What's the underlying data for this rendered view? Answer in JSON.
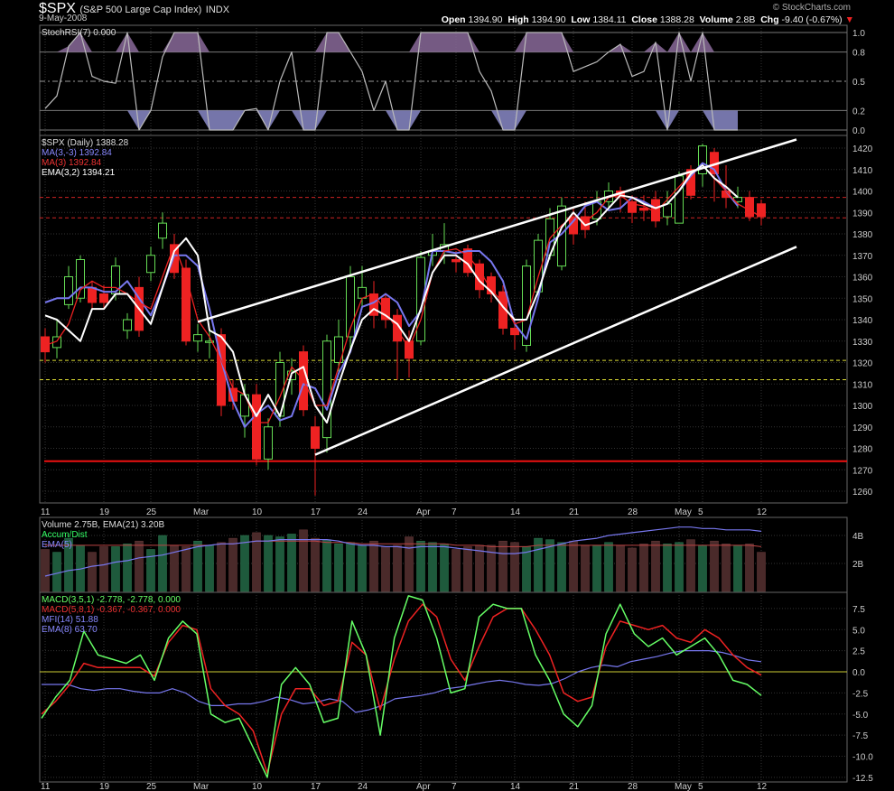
{
  "header": {
    "symbol": "$SPX",
    "description": "(S&P 500 Large Cap Index)",
    "exchange": "INDX",
    "date": "9-May-2008",
    "watermark": "© StockCharts.com",
    "open_label": "Open",
    "open": "1394.90",
    "high_label": "High",
    "high": "1394.90",
    "low_label": "Low",
    "low": "1384.11",
    "close_label": "Close",
    "close": "1388.28",
    "volume_label": "Volume",
    "volume": "2.8B",
    "chg_label": "Chg",
    "chg": "-9.40 (-0.67%)",
    "chg_marker": "▼"
  },
  "colors": {
    "up": "#66dd55",
    "down": "#ee2222",
    "ma33": "#7777ee",
    "ma3": "#ee2222",
    "ema32": "#ffffff",
    "stoch": "#bbbbbb",
    "accum": "#33ff66",
    "macd": "#66ff66",
    "macd_signal": "#ee2222",
    "mfi": "#7777ee"
  },
  "x_axis": {
    "ticks": [
      {
        "i": 0,
        "label": "11"
      },
      {
        "i": 5,
        "label": "19"
      },
      {
        "i": 9,
        "label": "25"
      },
      {
        "i": 13,
        "label": "Mar"
      },
      {
        "i": 18,
        "label": "10"
      },
      {
        "i": 23,
        "label": "17"
      },
      {
        "i": 27,
        "label": "24"
      },
      {
        "i": 32,
        "label": "Apr"
      },
      {
        "i": 35,
        "label": "7"
      },
      {
        "i": 40,
        "label": "14"
      },
      {
        "i": 45,
        "label": "21"
      },
      {
        "i": 50,
        "label": "28"
      },
      {
        "i": 54,
        "label": "May"
      },
      {
        "i": 56,
        "label": "5"
      },
      {
        "i": 61,
        "label": "12"
      }
    ]
  },
  "stoch_panel": {
    "legend": "StochRSI(7) 0.000",
    "y_ticks": [
      "1.0",
      "0.8",
      "0.5",
      "0.2",
      "0.0"
    ]
  },
  "price_panel": {
    "legend": [
      {
        "text": "$SPX (Daily) 1388.28",
        "color": "#dddddd"
      },
      {
        "text": "MA(3,-3) 1392.84",
        "color": "#8888ff"
      },
      {
        "text": "MA(3) 1392.84",
        "color": "#ee3333"
      },
      {
        "text": "EMA(3,2) 1394.21",
        "color": "#ffffff"
      }
    ],
    "y_ticks": [
      "1420",
      "1410",
      "1400",
      "1390",
      "1380",
      "1370",
      "1360",
      "1350",
      "1340",
      "1330",
      "1320",
      "1310",
      "1300",
      "1290",
      "1280",
      "1270",
      "1260"
    ]
  },
  "volume_panel": {
    "legend": [
      {
        "text": "Volume 2.75B, EMA(21) 3.20B",
        "color": "#dddddd"
      },
      {
        "text": "Accum/Dist",
        "color": "#33ff66"
      },
      {
        "text": "EMA(5)",
        "color": "#8888ff"
      }
    ],
    "y_ticks": [
      "4B",
      "2B"
    ]
  },
  "macd_panel": {
    "legend": [
      {
        "text": "MACD(3,5,1) -2.778, -2.778, 0.000",
        "color": "#66ff66"
      },
      {
        "text": "MACD(5,8,1) -0.367, -0.367, 0.000",
        "color": "#ee3333"
      },
      {
        "text": "MFI(14) 51.88",
        "color": "#8888ff"
      },
      {
        "text": "EMA(8) 63.70",
        "color": "#8888ff"
      }
    ],
    "y_ticks": [
      "7.5",
      "5.0",
      "2.5",
      "0.0",
      "-2.5",
      "-5.0",
      "-7.5",
      "-10.0",
      "-12.5"
    ]
  },
  "chart_data": {
    "type": "candlestick",
    "title": "$SPX (S&P 500 Large Cap Index)",
    "period": "Daily, 11-Feb-2008 to 9-May-2008",
    "candles": {
      "open": [
        1332,
        1327,
        1347,
        1350,
        1355,
        1352,
        1352,
        1335,
        1355,
        1362,
        1378,
        1375,
        1364,
        1330,
        1330,
        1333,
        1308,
        1295,
        1305,
        1275,
        1295,
        1312,
        1325,
        1290,
        1285,
        1320,
        1332,
        1350,
        1352,
        1350,
        1342,
        1330,
        1330,
        1370,
        1372,
        1368,
        1373,
        1366,
        1360,
        1353,
        1336,
        1328,
        1353,
        1370,
        1365,
        1388,
        1388,
        1387,
        1395,
        1400,
        1395,
        1392,
        1396,
        1388,
        1385,
        1410,
        1408,
        1418,
        1400,
        1395,
        1397,
        1394
      ],
      "close": [
        1325,
        1332,
        1360,
        1368,
        1348,
        1348,
        1365,
        1340,
        1335,
        1370,
        1385,
        1362,
        1330,
        1333,
        1330,
        1300,
        1302,
        1305,
        1275,
        1290,
        1320,
        1316,
        1298,
        1280,
        1330,
        1332,
        1360,
        1355,
        1342,
        1340,
        1330,
        1322,
        1369,
        1372,
        1375,
        1367,
        1362,
        1354,
        1352,
        1336,
        1333,
        1365,
        1377,
        1387,
        1393,
        1380,
        1382,
        1395,
        1400,
        1398,
        1390,
        1391,
        1386,
        1394,
        1407,
        1398,
        1421,
        1408,
        1397,
        1397,
        1388,
        1388
      ],
      "high": [
        1336,
        1340,
        1365,
        1370,
        1358,
        1356,
        1369,
        1343,
        1360,
        1374,
        1390,
        1380,
        1368,
        1338,
        1336,
        1336,
        1312,
        1310,
        1310,
        1294,
        1325,
        1322,
        1328,
        1295,
        1333,
        1340,
        1365,
        1365,
        1358,
        1352,
        1345,
        1335,
        1372,
        1380,
        1385,
        1372,
        1375,
        1368,
        1362,
        1356,
        1340,
        1368,
        1380,
        1392,
        1397,
        1392,
        1395,
        1400,
        1404,
        1402,
        1398,
        1398,
        1400,
        1400,
        1409,
        1412,
        1422,
        1420,
        1412,
        1402,
        1400,
        1396
      ],
      "low": [
        1320,
        1322,
        1345,
        1348,
        1345,
        1345,
        1349,
        1331,
        1332,
        1358,
        1373,
        1359,
        1328,
        1325,
        1322,
        1295,
        1298,
        1285,
        1272,
        1270,
        1290,
        1305,
        1295,
        1258,
        1278,
        1315,
        1325,
        1345,
        1336,
        1336,
        1312,
        1313,
        1328,
        1365,
        1366,
        1362,
        1360,
        1350,
        1348,
        1333,
        1326,
        1325,
        1350,
        1368,
        1363,
        1375,
        1378,
        1384,
        1392,
        1390,
        1385,
        1386,
        1383,
        1384,
        1385,
        1396,
        1402,
        1395,
        1392,
        1392,
        1386,
        1384
      ]
    },
    "ma_3_shift": [
      1348,
      1350,
      1350,
      1355,
      1355,
      1353,
      1353,
      1358,
      1350,
      1342,
      1355,
      1370,
      1370,
      1365,
      1345,
      1321,
      1302,
      1290,
      1296,
      1300,
      1293,
      1295,
      1310,
      1308,
      1298,
      1315,
      1325,
      1346,
      1348,
      1352,
      1348,
      1337,
      1344,
      1372,
      1372,
      1371,
      1372,
      1372,
      1367,
      1358,
      1338,
      1331,
      1350,
      1376,
      1380,
      1386,
      1393,
      1395,
      1391,
      1392,
      1397,
      1395,
      1392,
      1394,
      1400,
      1407,
      1413,
      1410,
      1400,
      1393
    ],
    "ma_3": [
      1328,
      1330,
      1338,
      1354,
      1358,
      1355,
      1355,
      1352,
      1348,
      1345,
      1360,
      1375,
      1360,
      1340,
      1332,
      1321,
      1308,
      1305,
      1292,
      1292,
      1304,
      1318,
      1312,
      1300,
      1300,
      1318,
      1336,
      1350,
      1352,
      1344,
      1335,
      1327,
      1340,
      1362,
      1372,
      1373,
      1370,
      1363,
      1354,
      1348,
      1338,
      1340,
      1360,
      1378,
      1384,
      1388,
      1386,
      1390,
      1397,
      1398,
      1394,
      1393,
      1390,
      1396,
      1402,
      1408,
      1412,
      1406,
      1400,
      1394,
      1391,
      1388
    ],
    "ema_3_2": [
      1342,
      1340,
      1335,
      1330,
      1345,
      1345,
      1352,
      1352,
      1345,
      1338,
      1355,
      1372,
      1378,
      1370,
      1335,
      1332,
      1325,
      1305,
      1295,
      1305,
      1295,
      1315,
      1318,
      1300,
      1292,
      1310,
      1326,
      1340,
      1345,
      1342,
      1338,
      1330,
      1345,
      1362,
      1370,
      1370,
      1366,
      1358,
      1353,
      1346,
      1340,
      1340,
      1353,
      1370,
      1383,
      1390,
      1384,
      1386,
      1392,
      1398,
      1397,
      1394,
      1392,
      1394,
      1400,
      1408,
      1412,
      1406,
      1402,
      1397
    ],
    "support_resistance": {
      "red_lines": [
        1397,
        1387.5
      ],
      "yellow_lines": [
        1321,
        1312
      ],
      "red_base": 1274
    },
    "channel": {
      "upper": [
        [
          13,
          1339
        ],
        [
          64,
          1424
        ]
      ],
      "lower": [
        [
          23,
          1277
        ],
        [
          64,
          1374
        ]
      ]
    },
    "stoch_rsi": [
      0.22,
      0.35,
      0.86,
      1.0,
      0.55,
      0.5,
      0.48,
      1.0,
      0.0,
      0.2,
      0.75,
      1.0,
      1.0,
      1.0,
      0.0,
      0.0,
      0.0,
      0.2,
      0.22,
      0.0,
      0.5,
      0.8,
      0.0,
      0.0,
      1.0,
      1.0,
      0.8,
      0.6,
      0.2,
      0.5,
      0.0,
      0.0,
      1.0,
      1.0,
      1.0,
      1.0,
      1.0,
      0.6,
      0.4,
      0.0,
      0.0,
      1.0,
      1.0,
      1.0,
      1.0,
      0.6,
      0.65,
      0.7,
      0.8,
      0.88,
      0.55,
      0.6,
      0.9,
      0.0,
      1.0,
      0.5,
      1.0,
      0.0,
      0.0,
      0.0
    ],
    "volume_b": [
      3.0,
      2.8,
      3.8,
      3.3,
      2.8,
      3.2,
      3.2,
      3.4,
      3.6,
      3.0,
      4.0,
      3.3,
      3.2,
      3.6,
      3.3,
      3.5,
      3.8,
      4.0,
      4.2,
      4.0,
      3.9,
      4.1,
      4.4,
      3.8,
      3.7,
      3.4,
      3.5,
      3.3,
      3.6,
      3.2,
      3.3,
      3.9,
      3.6,
      3.5,
      3.4,
      3.0,
      3.2,
      3.3,
      3.3,
      3.6,
      3.5,
      3.2,
      3.8,
      3.7,
      3.5,
      3.6,
      3.3,
      3.3,
      3.5,
      3.3,
      3.1,
      3.4,
      3.6,
      3.4,
      3.5,
      3.7,
      3.3,
      3.6,
      3.4,
      3.3,
      3.4,
      2.8
    ],
    "volume_ema21_b": [
      3.3,
      3.3,
      3.3,
      3.3,
      3.3,
      3.3,
      3.3,
      3.3,
      3.3,
      3.3,
      3.3,
      3.3,
      3.3,
      3.3,
      3.3,
      3.4,
      3.4,
      3.5,
      3.6,
      3.6,
      3.6,
      3.6,
      3.6,
      3.6,
      3.5,
      3.5,
      3.5,
      3.4,
      3.4,
      3.4,
      3.4,
      3.4,
      3.4,
      3.4,
      3.4,
      3.3,
      3.3,
      3.3,
      3.2,
      3.2,
      3.2,
      3.2,
      3.3,
      3.3,
      3.3,
      3.3,
      3.3,
      3.3,
      3.3,
      3.3,
      3.3,
      3.3,
      3.3,
      3.3,
      3.3,
      3.3,
      3.3,
      3.3,
      3.3,
      3.3,
      3.3,
      3.2
    ],
    "accum_dist_ema5_b": [
      1.1,
      1.3,
      1.5,
      1.6,
      1.8,
      1.9,
      2.1,
      2.2,
      2.4,
      2.5,
      2.6,
      2.8,
      3.0,
      3.2,
      3.3,
      3.4,
      3.4,
      3.5,
      3.6,
      3.6,
      3.7,
      3.7,
      3.7,
      3.7,
      3.7,
      3.6,
      3.4,
      3.3,
      3.3,
      3.2,
      3.2,
      3.1,
      3.2,
      3.2,
      3.2,
      3.1,
      3.0,
      2.9,
      2.8,
      2.7,
      2.7,
      2.8,
      3.0,
      3.2,
      3.4,
      3.6,
      3.7,
      3.8,
      4.0,
      4.1,
      4.2,
      4.3,
      4.4,
      4.5,
      4.6,
      4.6,
      4.5,
      4.5,
      4.4,
      4.4,
      4.4,
      4.3
    ],
    "macd_3_5_1": [
      -5.5,
      -3.0,
      -1.0,
      4.8,
      2.0,
      1.5,
      1.0,
      2.0,
      -1.0,
      4.0,
      6.0,
      4.5,
      -5.0,
      -6.0,
      -5.5,
      -9.0,
      -12.5,
      -1.5,
      0.5,
      -1.5,
      -6.0,
      -5.5,
      6.0,
      2.0,
      -7.5,
      4.0,
      9.0,
      8.5,
      4.0,
      -2.5,
      -2.0,
      6.5,
      8.0,
      7.5,
      7.5,
      2.0,
      -1.0,
      -5.0,
      -6.5,
      -4.0,
      4.5,
      8.0,
      4.5,
      3.0,
      4.0,
      2.0,
      3.0,
      4.0,
      2.0,
      -1.0,
      -1.5,
      -2.8
    ],
    "macd_5_8_1": [
      -5.0,
      -3.5,
      -1.5,
      1.0,
      0.5,
      0.5,
      0.5,
      0.5,
      -0.5,
      3.5,
      5.5,
      5.0,
      -2.0,
      -4.0,
      -5.0,
      -7.0,
      -12.0,
      -5.0,
      -2.0,
      -2.0,
      -4.0,
      -3.5,
      3.5,
      2.0,
      -4.5,
      1.5,
      6.0,
      8.0,
      6.5,
      1.5,
      -1.0,
      3.0,
      6.5,
      7.5,
      7.5,
      5.0,
      2.0,
      -2.5,
      -3.5,
      -3.0,
      3.0,
      6.0,
      5.5,
      5.0,
      5.5,
      4.0,
      3.5,
      5.0,
      4.0,
      2.0,
      0.5,
      -0.4
    ],
    "mfi_ema8_scaled": [
      -1.5,
      -1.5,
      -1.5,
      -2.0,
      -2.2,
      -2.0,
      -2.0,
      -2.3,
      -2.5,
      -2.5,
      -2.0,
      -2.5,
      -3.5,
      -4.0,
      -4.0,
      -3.8,
      -3.8,
      -3.5,
      -3.0,
      -3.3,
      -3.8,
      -3.6,
      -3.2,
      -3.5,
      -4.8,
      -4.5,
      -4.0,
      -3.2,
      -3.0,
      -2.8,
      -2.5,
      -2.0,
      -1.8,
      -1.5,
      -1.2,
      -1.0,
      -1.2,
      -1.5,
      -1.6,
      -1.4,
      -0.8,
      0.0,
      0.5,
      0.8,
      0.6,
      1.2,
      1.5,
      1.8,
      2.2,
      2.5,
      2.5,
      2.5,
      2.3,
      1.9,
      1.4,
      1.2
    ]
  }
}
